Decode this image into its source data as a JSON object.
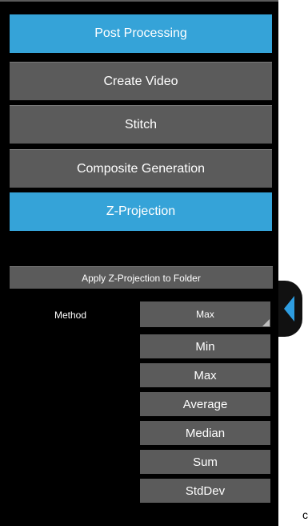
{
  "menu": {
    "post_processing": "Post Processing",
    "create_video": "Create Video",
    "stitch": "Stitch",
    "composite_generation": "Composite Generation",
    "z_projection": "Z-Projection"
  },
  "zprojection": {
    "apply_button": "Apply Z-Projection to Folder",
    "method_label": "Method",
    "selected_value": "Max",
    "options": [
      "Min",
      "Max",
      "Average",
      "Median",
      "Sum",
      "StdDev"
    ]
  },
  "side_tab": {
    "icon": "chevron-left-icon",
    "color": "#2e9de0"
  },
  "edge_text": "c",
  "colors": {
    "accent_blue": "#35a3d8",
    "button_gray": "#5b5b5b",
    "panel_bg": "#000000"
  }
}
